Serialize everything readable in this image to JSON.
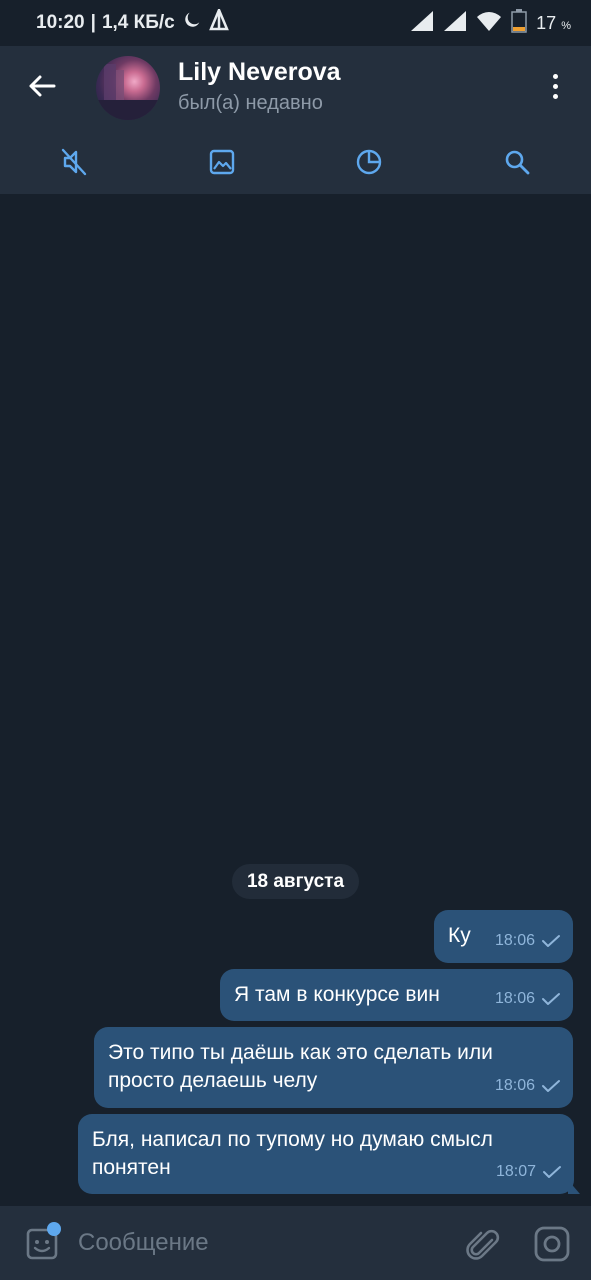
{
  "status_bar": {
    "time": "10:20",
    "separator": "|",
    "speed": "1,4 КБ/с",
    "battery": "17",
    "battery_unit": "%"
  },
  "header": {
    "contact_name": "Lily Neverova",
    "last_seen": "был(а) недавно"
  },
  "toolbar": {
    "icons": [
      "mute-icon",
      "gallery-icon",
      "timer-icon",
      "search-icon"
    ]
  },
  "chat": {
    "date_separator": "18 августа",
    "messages": [
      {
        "lines": [
          "Ку"
        ],
        "time": "18:06"
      },
      {
        "lines": [
          "Я там в конкурсе вин"
        ],
        "time": "18:06"
      },
      {
        "lines": [
          "Это типо ты даёшь как это сделать или",
          "просто делаешь челу"
        ],
        "time": "18:06"
      },
      {
        "lines": [
          "Бля, написал по тупому но думаю смысл",
          "понятен"
        ],
        "time": "18:07"
      }
    ]
  },
  "composer": {
    "placeholder": "Сообщение"
  },
  "colors": {
    "background": "#17202b",
    "header": "#242f3d",
    "bubble_out": "#2b5278",
    "accent": "#5ea8ee"
  }
}
